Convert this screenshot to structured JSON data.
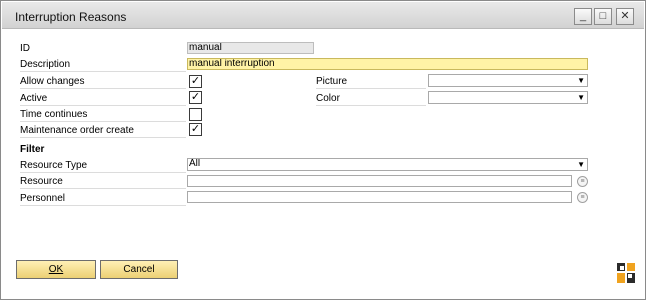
{
  "window": {
    "title": "Interruption Reasons",
    "minimize_symbol": "_",
    "maximize_symbol": "□",
    "close_symbol": "✕"
  },
  "form": {
    "id": {
      "label": "ID",
      "value": "manual"
    },
    "description": {
      "label": "Description",
      "value": "manual interruption"
    },
    "allow_changes": {
      "label": "Allow changes",
      "checked": true
    },
    "active": {
      "label": "Active",
      "checked": true
    },
    "time_continues": {
      "label": "Time continues",
      "checked": false
    },
    "maintenance_order_create": {
      "label": "Maintenance order create",
      "checked": true
    },
    "picture": {
      "label": "Picture",
      "value": ""
    },
    "color": {
      "label": "Color",
      "value": ""
    }
  },
  "filter": {
    "heading": "Filter",
    "resource_type": {
      "label": "Resource Type",
      "value": "All"
    },
    "resource": {
      "label": "Resource",
      "value": ""
    },
    "personnel": {
      "label": "Personnel",
      "value": ""
    }
  },
  "buttons": {
    "ok_label": "OK",
    "cancel_label": "Cancel"
  },
  "colors": {
    "button_bg": "#f4dd8a",
    "highlight_field": "#fff3a6",
    "logo_orange": "#f0a31f"
  },
  "icons": {
    "dropdown": "arrow-down-icon",
    "browse": "list-browse-icon",
    "check": "check-icon",
    "logo": "sap-business-one-logo-icon"
  }
}
